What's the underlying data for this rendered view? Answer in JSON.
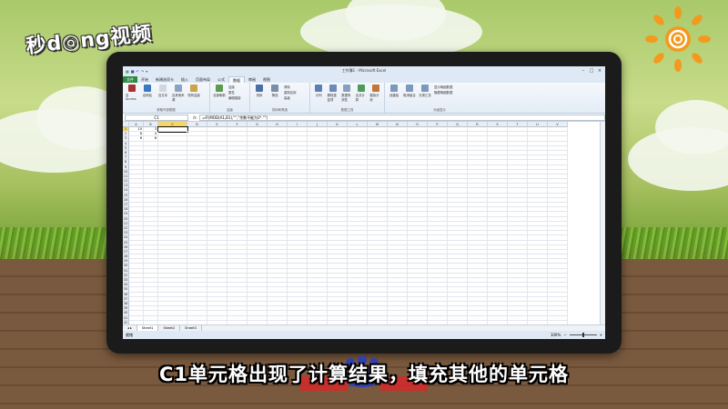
{
  "overlay": {
    "logo": "秒d◎ng视频",
    "caption": "C1单元格出现了计算结果，填充其他的单元格"
  },
  "excel": {
    "window_title": "工作簿1 - Microsoft Excel",
    "menu": [
      "文件",
      "开始",
      "新建选项卡",
      "插入",
      "页面布局",
      "公式",
      "数据",
      "审阅",
      "视图"
    ],
    "active_menu_index": 6,
    "ribbon": {
      "group1": {
        "label": "获取外部数据",
        "buttons": [
          "自 Access",
          "自网站",
          "自文本",
          "自其他来源",
          "现有连接"
        ]
      },
      "group2": {
        "label": "连接",
        "big": "全部刷新",
        "small": [
          "连接",
          "属性",
          "编辑链接"
        ]
      },
      "group3": {
        "label": "排序和筛选",
        "buttons": [
          "排序",
          "筛选"
        ],
        "small": [
          "清除",
          "重新应用",
          "高级"
        ]
      },
      "group4": {
        "label": "数据工具",
        "buttons": [
          "分列",
          "删除重复项",
          "数据有效性",
          "合并计算",
          "模拟分析"
        ]
      },
      "group5": {
        "label": "分级显示",
        "buttons": [
          "创建组",
          "取消组合",
          "分类汇总"
        ],
        "small": [
          "显示明细数据",
          "隐藏明细数据"
        ]
      }
    },
    "name_box": "C1",
    "fx": "fx",
    "formula": "=IF(MOD(A1,B1),\"\",\"余数不能为0\".\"\")",
    "columns": [
      "A",
      "B",
      "C",
      "D",
      "E",
      "F",
      "G",
      "H",
      "I",
      "J",
      "K",
      "L",
      "M",
      "N",
      "O",
      "P",
      "Q",
      "R",
      "S",
      "T",
      "U",
      "V"
    ],
    "rows_count": 42,
    "cells": {
      "A1": "10",
      "B1": "3",
      "A2": "8",
      "B2": "4",
      "A3": "6",
      "B3": "6"
    },
    "sheets": [
      "Sheet1",
      "Sheet2",
      "Sheet3"
    ],
    "status": "就绪",
    "zoom": "100%"
  },
  "colors": {
    "accent": "#2a8a3e",
    "ribbon": "#dfe9f5"
  }
}
